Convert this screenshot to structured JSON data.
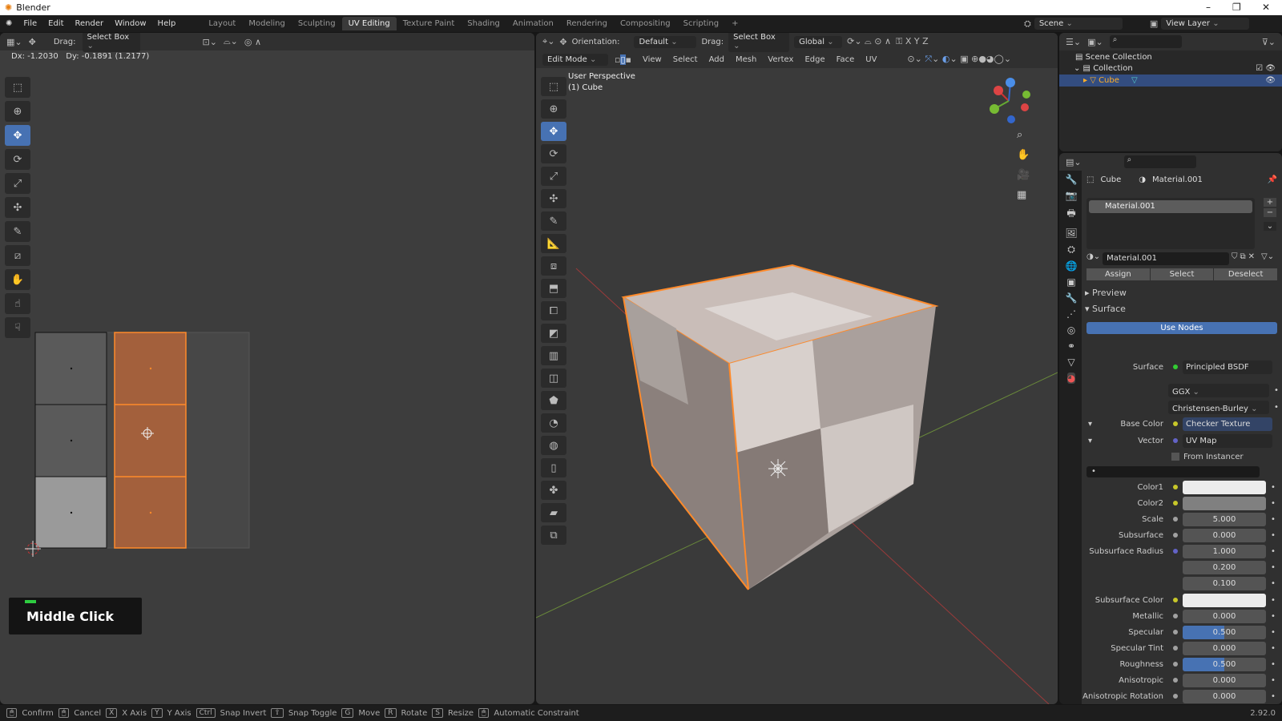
{
  "window": {
    "title": "Blender",
    "minimize": "–",
    "restore": "❐",
    "close": "✕"
  },
  "menu": [
    "File",
    "Edit",
    "Render",
    "Window",
    "Help"
  ],
  "workspaces": [
    "Layout",
    "Modeling",
    "Sculpting",
    "UV Editing",
    "Texture Paint",
    "Shading",
    "Animation",
    "Rendering",
    "Compositing",
    "Scripting",
    "+"
  ],
  "active_workspace": "UV Editing",
  "scene": {
    "label": "Scene",
    "view_layer": "View Layer"
  },
  "uv_editor": {
    "drag_label": "Drag:",
    "drag_value": "Select Box",
    "readout": "Dx: -1.2030   Dy: -0.1891 (1.2177)",
    "overlay_text": "Middle Click"
  },
  "viewport": {
    "orientation_label": "Orientation:",
    "orientation_value": "Default",
    "drag_label": "Drag:",
    "drag_value": "Select Box",
    "transform_value": "Global",
    "mode": "Edit Mode",
    "menus": [
      "View",
      "Select",
      "Add",
      "Mesh",
      "Vertex",
      "Edge",
      "Face",
      "UV"
    ],
    "perspective": "User Perspective",
    "object_name": "(1) Cube"
  },
  "outliner": {
    "scene_collection": "Scene Collection",
    "collection": "Collection",
    "object": "Cube"
  },
  "properties": {
    "breadcrumb_object": "Cube",
    "breadcrumb_material": "Material.001",
    "slot": "Material.001",
    "material_name": "Material.001",
    "assign": "Assign",
    "select": "Select",
    "deselect": "Deselect",
    "preview": "Preview",
    "surface_panel": "Surface",
    "use_nodes": "Use Nodes",
    "surface_label": "Surface",
    "surface_value": "Principled BSDF",
    "distribution": "GGX",
    "subsurface_method": "Christensen-Burley",
    "base_color_label": "Base Color",
    "base_color_value": "Checker Texture",
    "vector_label": "Vector",
    "vector_value": "UV Map",
    "from_instancer": "From Instancer",
    "rows": [
      {
        "label": "Color1",
        "socket": "#c7c729",
        "type": "color",
        "color": "#ececec"
      },
      {
        "label": "Color2",
        "socket": "#c7c729",
        "type": "color",
        "color": "#808080"
      },
      {
        "label": "Scale",
        "socket": "#a1a1a1",
        "value": "5.000"
      },
      {
        "label": "Subsurface",
        "socket": "#a1a1a1",
        "value": "0.000"
      },
      {
        "label": "Subsurface Radius",
        "socket": "#6363c7",
        "value": "1.000"
      },
      {
        "label": "",
        "socket": "",
        "value": "0.200"
      },
      {
        "label": "",
        "socket": "",
        "value": "0.100"
      },
      {
        "label": "Subsurface Color",
        "socket": "#c7c729",
        "type": "color",
        "color": "#ececec"
      },
      {
        "label": "Metallic",
        "socket": "#a1a1a1",
        "value": "0.000"
      },
      {
        "label": "Specular",
        "socket": "#a1a1a1",
        "value": "0.500",
        "fill": 0.5
      },
      {
        "label": "Specular Tint",
        "socket": "#a1a1a1",
        "value": "0.000"
      },
      {
        "label": "Roughness",
        "socket": "#a1a1a1",
        "value": "0.500",
        "fill": 0.5
      },
      {
        "label": "Anisotropic",
        "socket": "#a1a1a1",
        "value": "0.000"
      },
      {
        "label": "Anisotropic Rotation",
        "socket": "#a1a1a1",
        "value": "0.000"
      }
    ]
  },
  "status": {
    "items": [
      [
        "🖱",
        "Confirm"
      ],
      [
        "🖱",
        "Cancel"
      ],
      [
        "X",
        "X Axis"
      ],
      [
        "Y",
        "Y Axis"
      ],
      [
        "Ctrl",
        "Snap Invert"
      ],
      [
        "⇧",
        "Snap Toggle"
      ],
      [
        "G",
        "Move"
      ],
      [
        "R",
        "Rotate"
      ],
      [
        "S",
        "Resize"
      ],
      [
        "🖱",
        "Automatic Constraint"
      ]
    ],
    "version": "2.92.0"
  },
  "colors": {
    "accent": "#4772b3",
    "selection": "#e87d0d"
  }
}
